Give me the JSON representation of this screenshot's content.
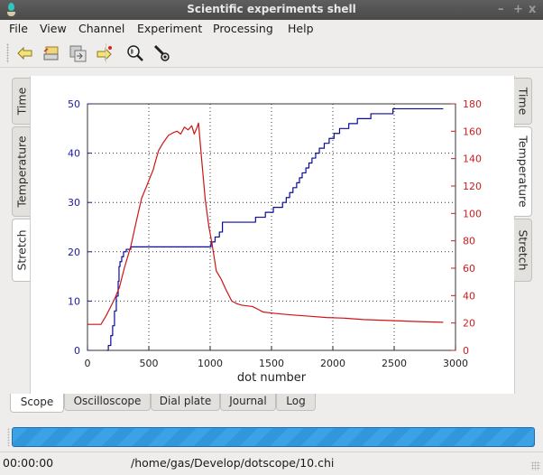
{
  "window": {
    "title": "Scientific experiments shell",
    "controls": {
      "minimize": "–",
      "maximize": "+",
      "close": "x"
    }
  },
  "menubar": [
    "File",
    "View",
    "Channel",
    "Experiment",
    "Processing",
    "Help"
  ],
  "toolbar": {
    "buttons": [
      {
        "name": "back-arrow-icon",
        "tooltip": ""
      },
      {
        "name": "open-folder-icon",
        "tooltip": ""
      },
      {
        "name": "export-icon",
        "tooltip": ""
      },
      {
        "name": "forward-new-icon",
        "tooltip": ""
      },
      {
        "name": "zoom-icon",
        "tooltip": ""
      },
      {
        "name": "probe-icon",
        "tooltip": ""
      }
    ]
  },
  "left_tabs": [
    {
      "label": "Time",
      "active": false
    },
    {
      "label": "Temperature",
      "active": false
    },
    {
      "label": "Stretch",
      "active": true
    }
  ],
  "right_tabs": [
    {
      "label": "Time",
      "active": false
    },
    {
      "label": "Temperature",
      "active": true
    },
    {
      "label": "Stretch",
      "active": false
    }
  ],
  "bottom_tabs": [
    {
      "label": "Scope",
      "active": true
    },
    {
      "label": "Oscilloscope",
      "active": false
    },
    {
      "label": "Dial plate",
      "active": false
    },
    {
      "label": "Journal",
      "active": false
    },
    {
      "label": "Log",
      "active": false
    }
  ],
  "progress": {
    "value": 1.0
  },
  "status": {
    "time": "00:00:00",
    "file": "/home/gas/Develop/dotscope/10.chi"
  },
  "colors": {
    "left_axis": "#1a1aa0",
    "right_axis": "#c81e1e",
    "stretch_series": "#0a0a9c",
    "temperature_series": "#d01414",
    "progress": "#3aa2e5"
  },
  "chart_data": {
    "type": "line",
    "title": "",
    "xlabel": "dot number",
    "ylabel_left": "",
    "ylabel_right": "",
    "xlim": [
      0,
      3000
    ],
    "ylim_left": [
      0,
      50
    ],
    "ylim_right": [
      0,
      180
    ],
    "x_ticks": [
      0,
      500,
      1000,
      1500,
      2000,
      2500,
      3000
    ],
    "y_ticks_left": [
      0,
      10,
      20,
      30,
      40,
      50
    ],
    "y_ticks_right": [
      0,
      20,
      40,
      60,
      80,
      100,
      120,
      140,
      160,
      180
    ],
    "grid": true,
    "series": [
      {
        "name": "Stretch",
        "axis": "left",
        "step": true,
        "x": [
          154,
          170,
          190,
          205,
          220,
          235,
          250,
          257,
          265,
          279,
          294,
          316,
          353,
          1007,
          1040,
          1075,
          1100,
          1370,
          1450,
          1515,
          1590,
          1620,
          1648,
          1675,
          1705,
          1728,
          1750,
          1780,
          1805,
          1830,
          1860,
          1890,
          1930,
          1970,
          2010,
          2055,
          2130,
          2200,
          2310,
          2490,
          2900
        ],
        "values": [
          0,
          1,
          3,
          5,
          8,
          11,
          14,
          17,
          18,
          19,
          20,
          20.5,
          21,
          22,
          23,
          24,
          26,
          27,
          28,
          29,
          30,
          31,
          32,
          33,
          34,
          35,
          36,
          37,
          38,
          39,
          40,
          41,
          42,
          43,
          44,
          45,
          46,
          47,
          48,
          49,
          49
        ]
      },
      {
        "name": "Temperature",
        "axis": "right",
        "step": false,
        "x": [
          0,
          60,
          110,
          150,
          190,
          228,
          260,
          300,
          353,
          400,
          441,
          478,
          500,
          536,
          551,
          580,
          620,
          660,
          700,
          730,
          760,
          790,
          820,
          850,
          870,
          890,
          905,
          930,
          960,
          990,
          1015,
          1050,
          1090,
          1125,
          1176,
          1220,
          1257,
          1300,
          1345,
          1390,
          1432,
          1530,
          1650,
          1800,
          1950,
          2100,
          2250,
          2400,
          2550,
          2700,
          2900
        ],
        "values": [
          19,
          19,
          19,
          25,
          32,
          39,
          46,
          60,
          76,
          95,
          111,
          119,
          124,
          132,
          137,
          146,
          152,
          157,
          159,
          160,
          158,
          163,
          161,
          164,
          158,
          162,
          166,
          140,
          110,
          90,
          78,
          58,
          52,
          45,
          36,
          34,
          33,
          32.5,
          32,
          30,
          28,
          27,
          26,
          25,
          24,
          23.5,
          22.5,
          22,
          21.5,
          21,
          20.5
        ]
      }
    ]
  }
}
